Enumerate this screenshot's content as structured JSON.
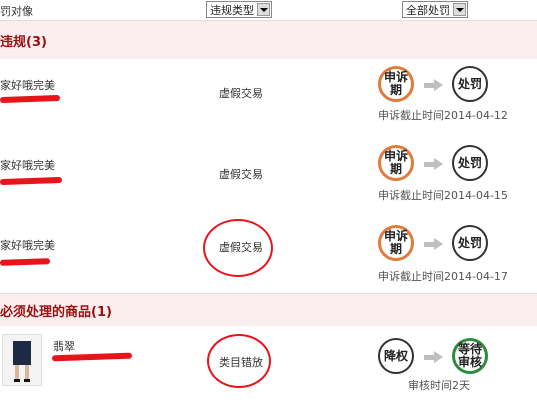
{
  "header": {
    "col1": "罚对像",
    "violation_type_select": "违规类型",
    "penalty_select": "全部处罚"
  },
  "sections": {
    "violations_title": "违规(3)",
    "products_title": "必须处理的商品(1)"
  },
  "violations": [
    {
      "user": "家好哦完美",
      "type": "虚假交易",
      "step1": "申诉期",
      "step2": "处罚",
      "deadline": "申诉截止时间2014-04-12"
    },
    {
      "user": "家好哦完美",
      "type": "虚假交易",
      "step1": "申诉期",
      "step2": "处罚",
      "deadline": "申诉截止时间2014-04-15"
    },
    {
      "user": "家好哦完美",
      "type": "虚假交易",
      "step1": "申诉期",
      "step2": "处罚",
      "deadline": "申诉截止时间2014-04-17"
    }
  ],
  "products": [
    {
      "title": "翡翠",
      "type": "类目错放",
      "step1": "降权",
      "step2": "等待审核",
      "status": "审核时间2天"
    }
  ],
  "colors": {
    "section_bg": "#fbeeee",
    "section_title": "#9a0f0f",
    "active_circle": "#e07b3c",
    "scribble": "#e8141a"
  }
}
